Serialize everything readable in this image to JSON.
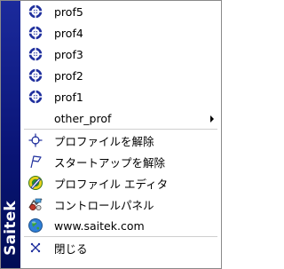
{
  "brand": {
    "name": "Saitek"
  },
  "profiles": [
    {
      "label": "prof5",
      "icon": "crosshair-target-icon"
    },
    {
      "label": "prof4",
      "icon": "crosshair-target-icon"
    },
    {
      "label": "prof3",
      "icon": "crosshair-target-icon"
    },
    {
      "label": "prof2",
      "icon": "crosshair-target-icon"
    },
    {
      "label": "prof1",
      "icon": "crosshair-target-icon"
    }
  ],
  "other_prof": {
    "label": "other_prof",
    "has_submenu": true
  },
  "actions": [
    {
      "label": "プロファイルを解除",
      "icon": "crosshair-outline-icon"
    },
    {
      "label": "スタートアップを解除",
      "icon": "flag-outline-icon"
    },
    {
      "label": "プロファイル エディタ",
      "icon": "profile-editor-icon"
    },
    {
      "label": "コントロールパネル",
      "icon": "control-panel-icon"
    },
    {
      "label": "www.saitek.com",
      "icon": "globe-icon"
    },
    {
      "label": "閉じる",
      "icon": "close-x-icon"
    }
  ],
  "colors": {
    "brand_bar_top": "#1b2a9c",
    "brand_bar_bottom": "#000d55",
    "target_icon": "#1f2f9d"
  }
}
